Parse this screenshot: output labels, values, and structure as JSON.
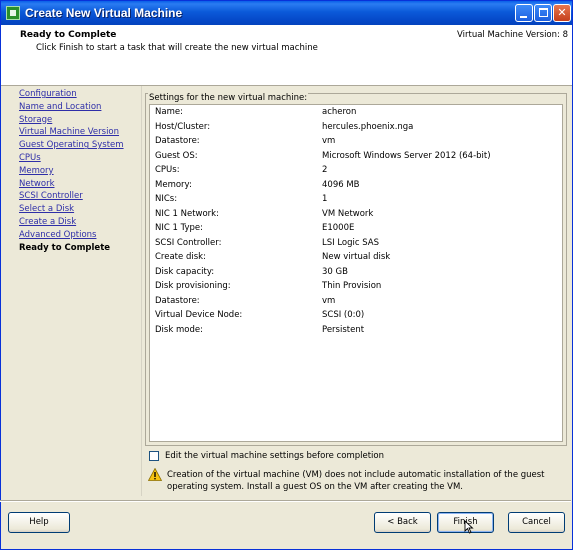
{
  "window": {
    "title": "Create New Virtual Machine"
  },
  "header": {
    "title": "Ready to Complete",
    "subtitle": "Click Finish to start a task that will create the new virtual machine",
    "version": "Virtual Machine Version: 8"
  },
  "nav": {
    "items": [
      {
        "label": "Configuration"
      },
      {
        "label": "Name and Location"
      },
      {
        "label": "Storage"
      },
      {
        "label": "Virtual Machine Version"
      },
      {
        "label": "Guest Operating System"
      },
      {
        "label": "CPUs"
      },
      {
        "label": "Memory"
      },
      {
        "label": "Network"
      },
      {
        "label": "SCSI Controller"
      },
      {
        "label": "Select a Disk"
      },
      {
        "label": "Create a Disk"
      },
      {
        "label": "Advanced Options"
      },
      {
        "label": "Ready to Complete"
      }
    ]
  },
  "settings": {
    "label": "Settings for the new virtual machine:",
    "rows": [
      {
        "k": "Name:",
        "v": "acheron"
      },
      {
        "k": "Host/Cluster:",
        "v": "hercules.phoenix.nga"
      },
      {
        "k": "Datastore:",
        "v": "vm"
      },
      {
        "k": "Guest OS:",
        "v": "Microsoft Windows Server 2012 (64-bit)"
      },
      {
        "k": "CPUs:",
        "v": "2"
      },
      {
        "k": "Memory:",
        "v": "4096 MB"
      },
      {
        "k": "NICs:",
        "v": "1"
      },
      {
        "k": "NIC 1 Network:",
        "v": "VM Network"
      },
      {
        "k": "NIC 1 Type:",
        "v": "E1000E"
      },
      {
        "k": "SCSI Controller:",
        "v": "LSI Logic SAS"
      },
      {
        "k": "Create disk:",
        "v": "New virtual disk"
      },
      {
        "k": "Disk capacity:",
        "v": "30 GB"
      },
      {
        "k": "Disk provisioning:",
        "v": "Thin Provision"
      },
      {
        "k": "Datastore:",
        "v": "vm"
      },
      {
        "k": "Virtual Device Node:",
        "v": "SCSI (0:0)"
      },
      {
        "k": "Disk mode:",
        "v": "Persistent"
      }
    ]
  },
  "edit_option": {
    "label": "Edit the virtual machine settings before completion",
    "checked": false
  },
  "warning": {
    "text": "Creation of the virtual machine (VM) does not include automatic installation of the guest operating system. Install a guest OS on the VM after creating the VM."
  },
  "buttons": {
    "help": "Help",
    "back": "< Back",
    "finish": "Finish",
    "cancel": "Cancel"
  },
  "colors": {
    "title_bar": "#0a5fe8",
    "dialog_bg": "#ece9d8",
    "link": "#2e2ea8",
    "warning": "#f5c211"
  },
  "icons": {
    "app": "vm-app-icon",
    "warning": "warning-icon",
    "minimize": "minimize-icon",
    "maximize": "maximize-icon",
    "close": "close-icon"
  }
}
